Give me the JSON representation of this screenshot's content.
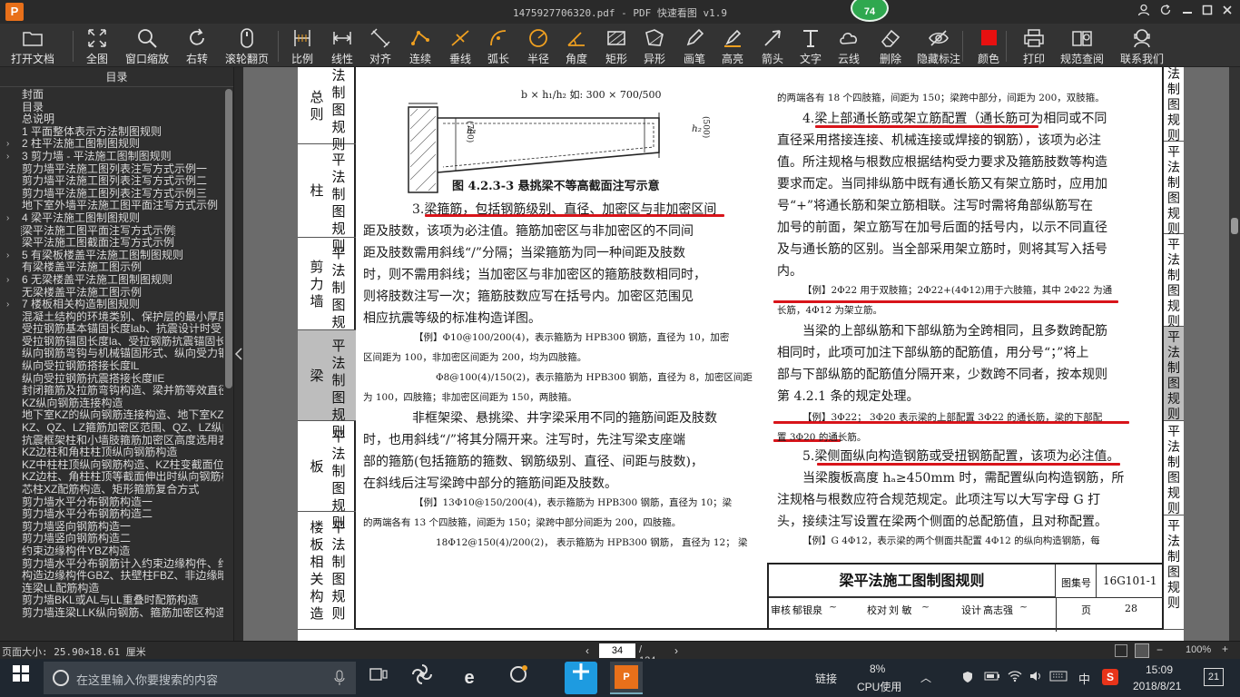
{
  "window": {
    "title": "1475927706320.pdf - PDF 快速看图 v1.9",
    "app_logo": "P",
    "badge": "74",
    "controls": [
      "user-icon",
      "refresh-icon",
      "minimize-icon",
      "maximize-icon",
      "close-icon"
    ]
  },
  "toolbar": {
    "items": [
      {
        "label": "打开文档",
        "icon": "folder-icon"
      },
      {
        "label": "全图",
        "icon": "fit-icon"
      },
      {
        "label": "窗口缩放",
        "icon": "zoom-icon"
      },
      {
        "label": "右转",
        "icon": "rotate-icon"
      },
      {
        "label": "滚轮翻页",
        "icon": "mouse-icon"
      },
      {
        "label": "比例",
        "icon": "scale-icon"
      },
      {
        "label": "线性",
        "icon": "linear-icon"
      },
      {
        "label": "对齐",
        "icon": "align-icon"
      },
      {
        "label": "连续",
        "icon": "continuous-icon"
      },
      {
        "label": "垂线",
        "icon": "perpendicular-icon"
      },
      {
        "label": "弧长",
        "icon": "arc-icon"
      },
      {
        "label": "半径",
        "icon": "radius-icon"
      },
      {
        "label": "角度",
        "icon": "angle-icon"
      },
      {
        "label": "矩形",
        "icon": "rectangle-icon"
      },
      {
        "label": "异形",
        "icon": "polygon-icon"
      },
      {
        "label": "画笔",
        "icon": "pen-icon"
      },
      {
        "label": "高亮",
        "icon": "highlight-icon"
      },
      {
        "label": "箭头",
        "icon": "arrow-icon"
      },
      {
        "label": "文字",
        "icon": "text-icon"
      },
      {
        "label": "云线",
        "icon": "cloud-icon"
      },
      {
        "label": "删除",
        "icon": "eraser-icon"
      },
      {
        "label": "隐藏标注",
        "icon": "eye-hide-icon"
      },
      {
        "label": "颜色",
        "icon": "color-icon"
      },
      {
        "label": "打印",
        "icon": "print-icon"
      },
      {
        "label": "规范查阅",
        "icon": "book-icon"
      },
      {
        "label": "联系我们",
        "icon": "contact-icon"
      }
    ],
    "accent_color": "#f0a020",
    "color_swatch": "#e81010"
  },
  "sidebar": {
    "title": "目录",
    "items": [
      {
        "label": "封面",
        "arrow": ""
      },
      {
        "label": "目录",
        "arrow": ""
      },
      {
        "label": "总说明",
        "arrow": ""
      },
      {
        "label": "1  平面整体表示方法制图规则",
        "arrow": ""
      },
      {
        "label": "2  柱平法施工图制图规则",
        "arrow": "›"
      },
      {
        "label": "3  剪力墙 - 平法施工图制图规则",
        "arrow": "›"
      },
      {
        "label": "剪力墙平法施工图列表注写方式示例一",
        "arrow": ""
      },
      {
        "label": "剪力墙平法施工图列表注写方式示例二",
        "arrow": ""
      },
      {
        "label": "剪力墙平法施工图列表注写方式示例三",
        "arrow": ""
      },
      {
        "label": "地下室外墙平法施工图平面注写方式示例",
        "arrow": ""
      },
      {
        "label": "4  梁平法施工图制图规则",
        "arrow": "›"
      },
      {
        "label": "梁平法施工图平面注写方式示例",
        "arrow": "",
        "selected": true
      },
      {
        "label": "梁平法施工图截面注写方式示例",
        "arrow": ""
      },
      {
        "label": "5  有梁板楼盖平法施工图制图规则",
        "arrow": "›"
      },
      {
        "label": "有梁楼盖平法施工图示例",
        "arrow": ""
      },
      {
        "label": "6  无梁楼盖平法施工图制图规则",
        "arrow": "›"
      },
      {
        "label": "无梁楼盖平法施工图示例",
        "arrow": ""
      },
      {
        "label": "7  楼板相关构造制图规则",
        "arrow": "›"
      },
      {
        "label": "混凝土结构的环境类别、保护层的最小厚度",
        "arrow": ""
      },
      {
        "label": "受拉钢筋基本锚固长度lab、抗震设计时受",
        "arrow": ""
      },
      {
        "label": "受拉钢筋锚固长度la、受拉钢筋抗震锚固长",
        "arrow": ""
      },
      {
        "label": "纵向钢筋弯钩与机械锚固形式、纵向受力钢",
        "arrow": ""
      },
      {
        "label": "纵向受拉钢筋搭接长度lL",
        "arrow": ""
      },
      {
        "label": "纵向受拉钢筋抗震搭接长度llE",
        "arrow": ""
      },
      {
        "label": "封闭箍筋及拉筋弯钩构造、梁并筋等效直径",
        "arrow": ""
      },
      {
        "label": "KZ纵向钢筋连接构造",
        "arrow": ""
      },
      {
        "label": "地下室KZ的纵向钢筋连接构造、地下室KZ的",
        "arrow": ""
      },
      {
        "label": "KZ、QZ、LZ箍筋加密区范围、QZ、LZ纵向钢",
        "arrow": ""
      },
      {
        "label": "抗震框架柱和小墙肢箍筋加密区高度选用表",
        "arrow": ""
      },
      {
        "label": "KZ边柱和角柱柱顶纵向钢筋构造",
        "arrow": ""
      },
      {
        "label": "KZ中柱柱顶纵向钢筋构造、KZ柱变截面位置",
        "arrow": ""
      },
      {
        "label": "KZ边柱、角柱柱顶等截面伸出时纵向钢筋构",
        "arrow": ""
      },
      {
        "label": "芯柱XZ配筋构造、矩形箍筋复合方式",
        "arrow": ""
      },
      {
        "label": "剪力墙水平分布钢筋构造一",
        "arrow": ""
      },
      {
        "label": "剪力墙水平分布钢筋构造二",
        "arrow": ""
      },
      {
        "label": "剪力墙竖向钢筋构造一",
        "arrow": ""
      },
      {
        "label": "剪力墙竖向钢筋构造二",
        "arrow": ""
      },
      {
        "label": "约束边缘构件YBZ构造",
        "arrow": ""
      },
      {
        "label": "剪力墙水平分布钢筋计入约束边缘构件、约",
        "arrow": ""
      },
      {
        "label": "构造边缘构件GBZ、扶壁柱FBZ、非边缘暗柱",
        "arrow": ""
      },
      {
        "label": "连梁LL配筋构造",
        "arrow": ""
      },
      {
        "label": "剪力墙BKL或AL与LL重叠时配筋构造",
        "arrow": ""
      },
      {
        "label": "剪力墙连梁LLK纵向钢筋、箍筋加密区构造",
        "arrow": ""
      }
    ]
  },
  "page": {
    "left_tabs": [
      {
        "c1": "总则",
        "c2": "法制图规则"
      },
      {
        "c1": "柱",
        "c2": "平法制图规则"
      },
      {
        "c1": "剪力墙",
        "c2": "平法制图规则"
      },
      {
        "c1": "梁",
        "c2": "平法制图规则",
        "active": true
      },
      {
        "c1": "板",
        "c2": "平法制图规则"
      },
      {
        "c1": "楼板相关构造",
        "c2": "平法制图规则"
      }
    ],
    "right_tabs": [
      {
        "c": "法制图规则"
      },
      {
        "c": "平法制图规则"
      },
      {
        "c": "平法制图规则"
      },
      {
        "c": "平法制图规则",
        "active": true
      },
      {
        "c": "平法制图规则"
      },
      {
        "c": "平法制图规则"
      }
    ],
    "figure": {
      "formula": "b × h₁/h₂  如: 300 × 700/500",
      "h1": "h₁",
      "dim1": "(700)",
      "h2": "h₂",
      "dim2": "(500)",
      "caption": "图 4.2.3-3  悬挑梁不等高截面注写示意"
    },
    "left_col": [
      "3.梁箍筋，包括钢筋级别、直径、加密区与非加密区间",
      "距及肢数，该项为必注值。箍筋加密区与非加密区的不同间",
      "距及肢数需用斜线“/”分隔；当梁箍筋为同一种间距及肢数",
      "时，则不需用斜线；当加密区与非加密区的箍筋肢数相同时，",
      "则将肢数注写一次；箍筋肢数应写在括号内。加密区范围见",
      "相应抗震等级的标准构造详图。",
      "【例】Φ10@100/200(4)，表示箍筋为 HPB300 钢筋，直径为 10，加密",
      "区间距为 100，非加密区间距为 200，均为四肢箍。",
      "Φ8@100(4)/150(2)，表示箍筋为 HPB300 钢筋，直径为 8，加密区间距",
      "为 100，四肢箍；非加密区间距为 150，两肢箍。",
      "非框架梁、悬挑梁、井字梁采用不同的箍筋间距及肢数",
      "时，也用斜线“/”将其分隔开来。注写时，先注写梁支座端",
      "部的箍筋(包括箍筋的箍数、钢筋级别、直径、间距与肢数)，",
      "在斜线后注写梁跨中部分的箍筋间距及肢数。",
      "【例】13Φ10@150/200(4)，表示箍筋为 HPB300 钢筋，直径为 10；梁",
      "的两端各有 13 个四肢箍，间距为 150；梁跨中部分间距为 200，四肢箍。",
      "18Φ12@150(4)/200(2)，  表示箍筋为 HPB300 钢筋，  直径为 12；  梁"
    ],
    "right_col": [
      "的两端各有 18 个四肢箍，间距为 150；梁跨中部分，间距为 200，双肢箍。",
      "4.梁上部通长筋或架立筋配置（通长筋可为相同或不同",
      "直径采用搭接连接、机械连接或焊接的钢筋），该项为必注",
      "值。所注规格与根数应根据结构受力要求及箍筋肢数等构造",
      "要求而定。当同排纵筋中既有通长筋又有架立筋时，应用加",
      "号“+”将通长筋和架立筋相联。注写时需将角部纵筋写在",
      "加号的前面，架立筋写在加号后面的括号内，以示不同直径",
      "及与通长筋的区别。当全部采用架立筋时，则将其写入括号",
      "内。",
      "【例】2Φ22 用于双肢箍；2Φ22+(4Φ12)用于六肢箍，其中 2Φ22 为通",
      "长筋，4Φ12 为架立筋。",
      "当梁的上部纵筋和下部纵筋为全跨相同，且多数跨配筋",
      "相同时，此项可加注下部纵筋的配筋值，用分号“；”将上",
      "部与下部纵筋的配筋值分隔开来，少数跨不同者，按本规则",
      "第 4.2.1 条的规定处理。",
      "【例】3Φ22；  3Φ20 表示梁的上部配置 3Φ22 的通长筋，梁的下部配",
      "置 3Φ20 的通长筋。",
      "5.梁侧面纵向构造钢筋或受扭钢筋配置，该项为必注值。",
      "当梁腹板高度 hₐ≥450mm 时，需配置纵向构造钢筋，所",
      "注规格与根数应符合规范规定。此项注写以大写字母 G 打",
      "头，接续注写设置在梁两个侧面的总配筋值，且对称配置。",
      "【例】G 4Φ12，表示梁的两个侧面共配置 4Φ12 的纵向构造钢筋，每"
    ],
    "title_block": {
      "title": "梁平法施工图制图规则",
      "atlas_label": "图集号",
      "atlas_no": "16G101-1",
      "review_label": "审核",
      "reviewer": "郁银泉",
      "check_label": "校对",
      "checker": "刘  敏",
      "design_label": "设计",
      "designer": "高志强",
      "page_label": "页",
      "page_no": "28"
    }
  },
  "status": {
    "page_size": "页面大小: 25.90×18.61 厘米",
    "current_page": "34",
    "total_pages": "/ 124",
    "zoom": "100%"
  },
  "taskbar": {
    "search_placeholder": "在这里输入你要搜索的内容",
    "cpu_percent": "8%",
    "cpu_label": "CPU使用",
    "link_label": "链接",
    "ime": "中",
    "time": "15:09",
    "date": "2018/8/21",
    "notifications": "21"
  }
}
